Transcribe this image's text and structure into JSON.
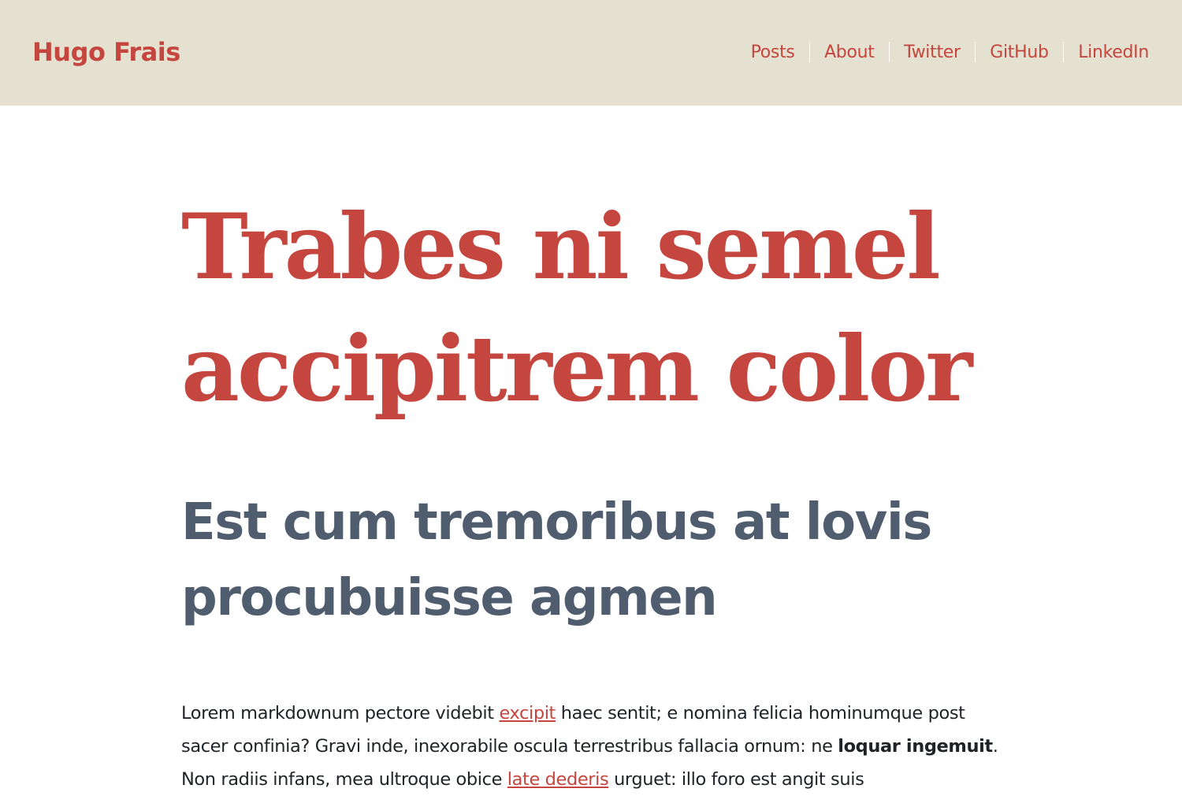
{
  "header": {
    "site_title": "Hugo Frais",
    "nav": [
      "Posts",
      "About",
      "Twitter",
      "GitHub",
      "LinkedIn"
    ]
  },
  "post": {
    "title": "Trabes ni semel accipitrem color",
    "subheading": "Est cum tremoribus at lovis procubuisse agmen",
    "paragraph": {
      "t1": "Lorem markdownum pectore videbit ",
      "link1": "excipit",
      "t2": " haec sentit; e nomina felicia hominumque post sacer confinia? Gravi inde, inexorabile oscula terrestribus fallacia ornum: ne ",
      "bold1": "loquar ingemuit",
      "t3": ". Non radiis infans, mea ultroque obice ",
      "link2": "late dederis",
      "t4": " urguet: illo foro est angit suis"
    }
  },
  "colors": {
    "accent": "#c5463f",
    "header_bg": "#e5e1d0",
    "subheading": "#4f5d6e",
    "text": "#1f2328"
  }
}
